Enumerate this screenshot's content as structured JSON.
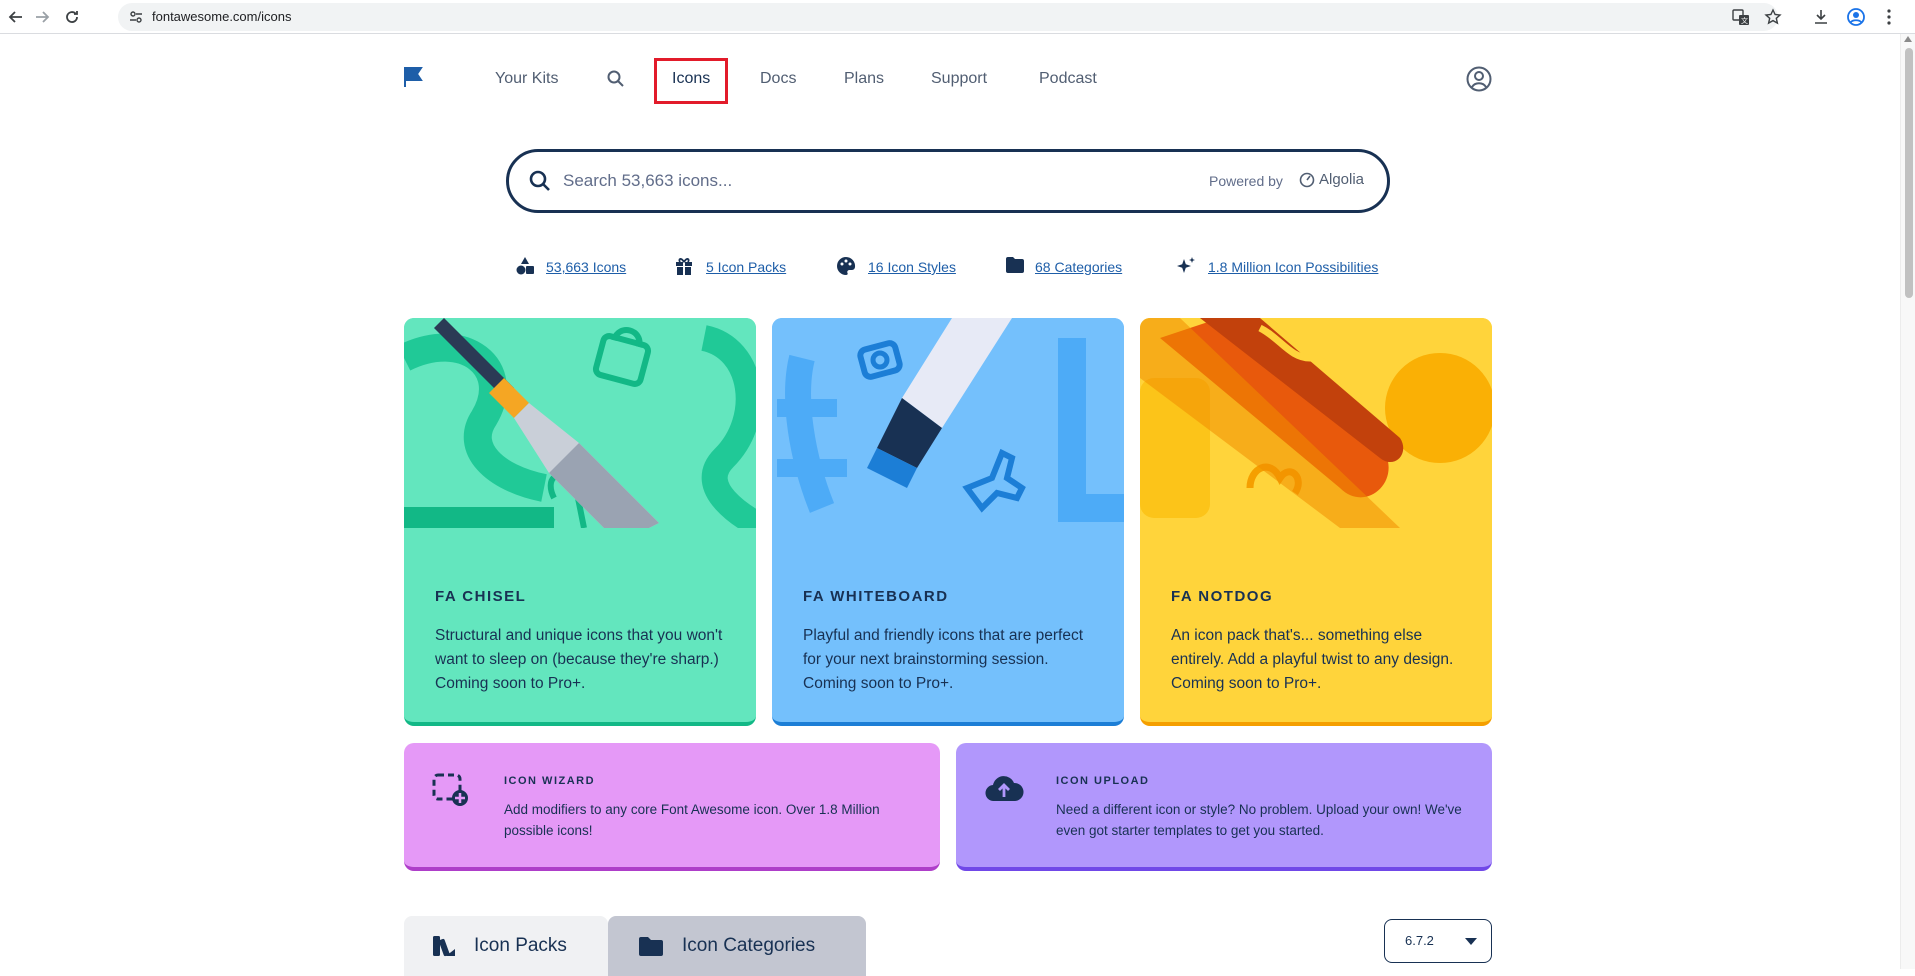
{
  "browser": {
    "url": "fontawesome.com/icons"
  },
  "nav": {
    "items": [
      "Your Kits",
      "Icons",
      "Docs",
      "Plans",
      "Support",
      "Podcast"
    ]
  },
  "search": {
    "placeholder": "Search 53,663 icons...",
    "powered_by": "Powered by",
    "provider": "Algolia"
  },
  "stats": [
    {
      "label": "53,663 Icons",
      "icon": "shapes-icon"
    },
    {
      "label": "5 Icon Packs",
      "icon": "gift-icon"
    },
    {
      "label": "16 Icon Styles",
      "icon": "palette-icon"
    },
    {
      "label": "68 Categories",
      "icon": "folder-icon"
    },
    {
      "label": "1.8 Million Icon Possibilities",
      "icon": "sparkles-icon"
    }
  ],
  "packs": [
    {
      "title": "FA CHISEL",
      "desc": "Structural and unique icons that you won't want to sleep on (because they're sharp.) Coming soon to Pro+.",
      "color": "#63e6be"
    },
    {
      "title": "FA WHITEBOARD",
      "desc": "Playful and friendly icons that are perfect for your next brainstorming session. Coming soon to Pro+.",
      "color": "#74c0fc"
    },
    {
      "title": "FA NOTDOG",
      "desc": "An icon pack that's... something else entirely. Add a playful twist to any design. Coming soon to Pro+.",
      "color": "#ffd43b"
    }
  ],
  "features": [
    {
      "title": "ICON WIZARD",
      "desc": "Add modifiers to any core Font Awesome icon. Over 1.8 Million possible icons!",
      "color": "#e599f7"
    },
    {
      "title": "ICON UPLOAD",
      "desc": "Need a different icon or style? No problem. Upload your own! We've even got starter templates to get you started.",
      "color": "#b197fc"
    }
  ],
  "tabs": [
    "Icon Packs",
    "Icon Categories"
  ],
  "version": "6.7.2"
}
